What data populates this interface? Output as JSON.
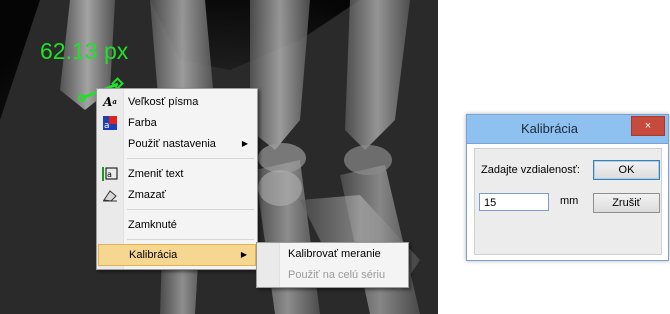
{
  "viewer": {
    "measurement_label": "62.13 px",
    "measure_color": "#22e02a"
  },
  "context_menu": {
    "items": [
      {
        "label": "Veľkosť písma",
        "icon": "font-size-icon"
      },
      {
        "label": "Farba",
        "icon": "color-icon"
      },
      {
        "label": "Použiť nastavenia",
        "icon": "",
        "submenu": true
      },
      {
        "label": "Zmeniť text",
        "icon": "edit-text-icon"
      },
      {
        "label": "Zmazať",
        "icon": "eraser-icon"
      },
      {
        "label": "Zamknuté",
        "icon": ""
      },
      {
        "label": "Kalibrácia",
        "icon": "",
        "submenu": true,
        "selected": true
      }
    ],
    "highlight_color": "#f6d792"
  },
  "submenu": {
    "items": [
      {
        "label": "Kalibrovať meranie",
        "enabled": true
      },
      {
        "label": "Použiť na celú sériu",
        "enabled": false
      }
    ]
  },
  "dialog": {
    "title": "Kalibrácia",
    "close_glyph": "×",
    "prompt": "Zadajte vzdialenosť:",
    "value": "15",
    "unit": "mm",
    "ok_label": "OK",
    "cancel_label": "Zrušiť",
    "titlebar_color": "#8ec1f0",
    "close_color": "#c74b3c"
  }
}
